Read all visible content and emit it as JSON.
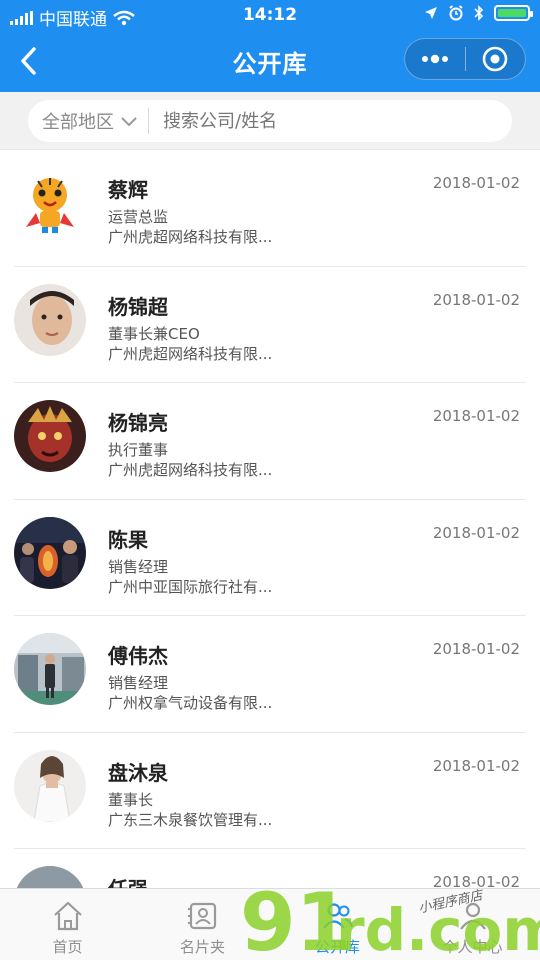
{
  "status_bar": {
    "carrier": "中国联通",
    "time": "14:12"
  },
  "nav": {
    "title": "公开库",
    "back_icon": "chevron-left-icon",
    "more_icon": "more-dots-icon",
    "close_icon": "target-circle-icon"
  },
  "search": {
    "region_label": "全部地区",
    "placeholder": "搜索公司/姓名"
  },
  "list": [
    {
      "name": "蔡辉",
      "role": "运营总监",
      "company": "广州虎超网络科技有限...",
      "date": "2018-01-02",
      "avatar": "tiger-mascot"
    },
    {
      "name": "杨锦超",
      "role": "董事长兼CEO",
      "company": "广州虎超网络科技有限...",
      "date": "2018-01-02",
      "avatar": "portrait-man"
    },
    {
      "name": "杨锦亮",
      "role": "执行董事",
      "company": "广州虎超网络科技有限...",
      "date": "2018-01-02",
      "avatar": "red-mask"
    },
    {
      "name": "陈果",
      "role": "销售经理",
      "company": "广州中亚国际旅行社有...",
      "date": "2018-01-02",
      "avatar": "night-scene"
    },
    {
      "name": "傅伟杰",
      "role": "销售经理",
      "company": "广州权拿气动设备有限...",
      "date": "2018-01-02",
      "avatar": "factory-scene"
    },
    {
      "name": "盘沐泉",
      "role": "董事长",
      "company": "广东三木泉餐饮管理有...",
      "date": "2018-01-02",
      "avatar": "portrait-woman"
    },
    {
      "name": "任强",
      "role": "",
      "company": "",
      "date": "2018-01-02",
      "avatar": "outdoor-scene"
    }
  ],
  "tabs": [
    {
      "label": "首页",
      "icon": "home-icon"
    },
    {
      "label": "名片夹",
      "icon": "card-holder-icon"
    },
    {
      "label": "公开库",
      "icon": "people-icon"
    },
    {
      "label": "个人中心",
      "icon": "person-icon"
    }
  ],
  "watermark": {
    "number": "91",
    "text": "rd.com",
    "tagline": "小程序商店"
  },
  "colors": {
    "primary": "#1f8ef1",
    "watermark_green": "#8cd12a"
  }
}
